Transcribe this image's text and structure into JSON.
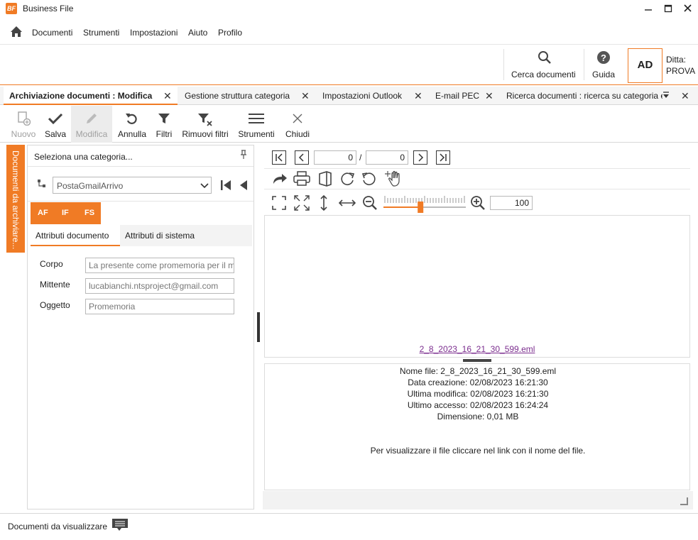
{
  "app": {
    "title": "Business File",
    "logo_text": "BF",
    "accent": "#f07b25"
  },
  "window_controls": {
    "minimize": "minimize-icon",
    "maximize": "maximize-icon",
    "close": "close-icon"
  },
  "menu": {
    "home_icon": "home-icon",
    "items": [
      "Documenti",
      "Strumenti",
      "Impostazioni",
      "Aiuto",
      "Profilo"
    ]
  },
  "topbar": {
    "search_label": "Cerca documenti",
    "help_label": "Guida",
    "avatar": "AD",
    "company_label": "Ditta:",
    "company_value": "PROVA"
  },
  "tabs": [
    {
      "label": "Archiviazione documenti : Modifica",
      "active": true
    },
    {
      "label": "Gestione struttura categoria",
      "active": false
    },
    {
      "label": "Impostazioni Outlook",
      "active": false
    },
    {
      "label": "E-mail PEC",
      "active": false
    },
    {
      "label": "Ricerca documenti : ricerca su categoria e",
      "active": false
    }
  ],
  "ribbon": {
    "nuovo": "Nuovo",
    "salva": "Salva",
    "modifica": "Modifica",
    "annulla": "Annulla",
    "filtri": "Filtri",
    "rimuovi_filtri": "Rimuovi filtri",
    "strumenti": "Strumenti",
    "chiudi": "Chiudi"
  },
  "side_tab": "Documenti da archiviare...",
  "left_panel": {
    "header": "Seleziona una categoria...",
    "category_value": "PostaGmailArrivo",
    "mini_tabs": [
      "AF",
      "IF",
      "FS"
    ],
    "attr_tabs": [
      "Attributi documento",
      "Attributi di sistema"
    ],
    "fields": [
      {
        "label": "Corpo",
        "value": "La presente come promemoria per il m"
      },
      {
        "label": "Mittente",
        "value": "lucabianchi.ntsproject@gmail.com"
      },
      {
        "label": "Oggetto",
        "value": "Promemoria"
      }
    ]
  },
  "viewer": {
    "page_current": "0",
    "page_separator": "/",
    "page_total": "0",
    "zoom_value": "100",
    "zoom_level": 0.45,
    "file_link": "2_8_2023_16_21_30_599.eml",
    "info": [
      "Nome file: 2_8_2023_16_21_30_599.eml",
      "Data creazione: 02/08/2023 16:21:30",
      "Ultima modifica: 02/08/2023 16:21:30",
      "Ultimo accesso: 02/08/2023 16:24:24",
      "Dimensione: 0,01 MB"
    ],
    "hint": "Per visualizzare il file cliccare nel link con il nome del file."
  },
  "statusbar": {
    "label": "Documenti da visualizzare"
  }
}
